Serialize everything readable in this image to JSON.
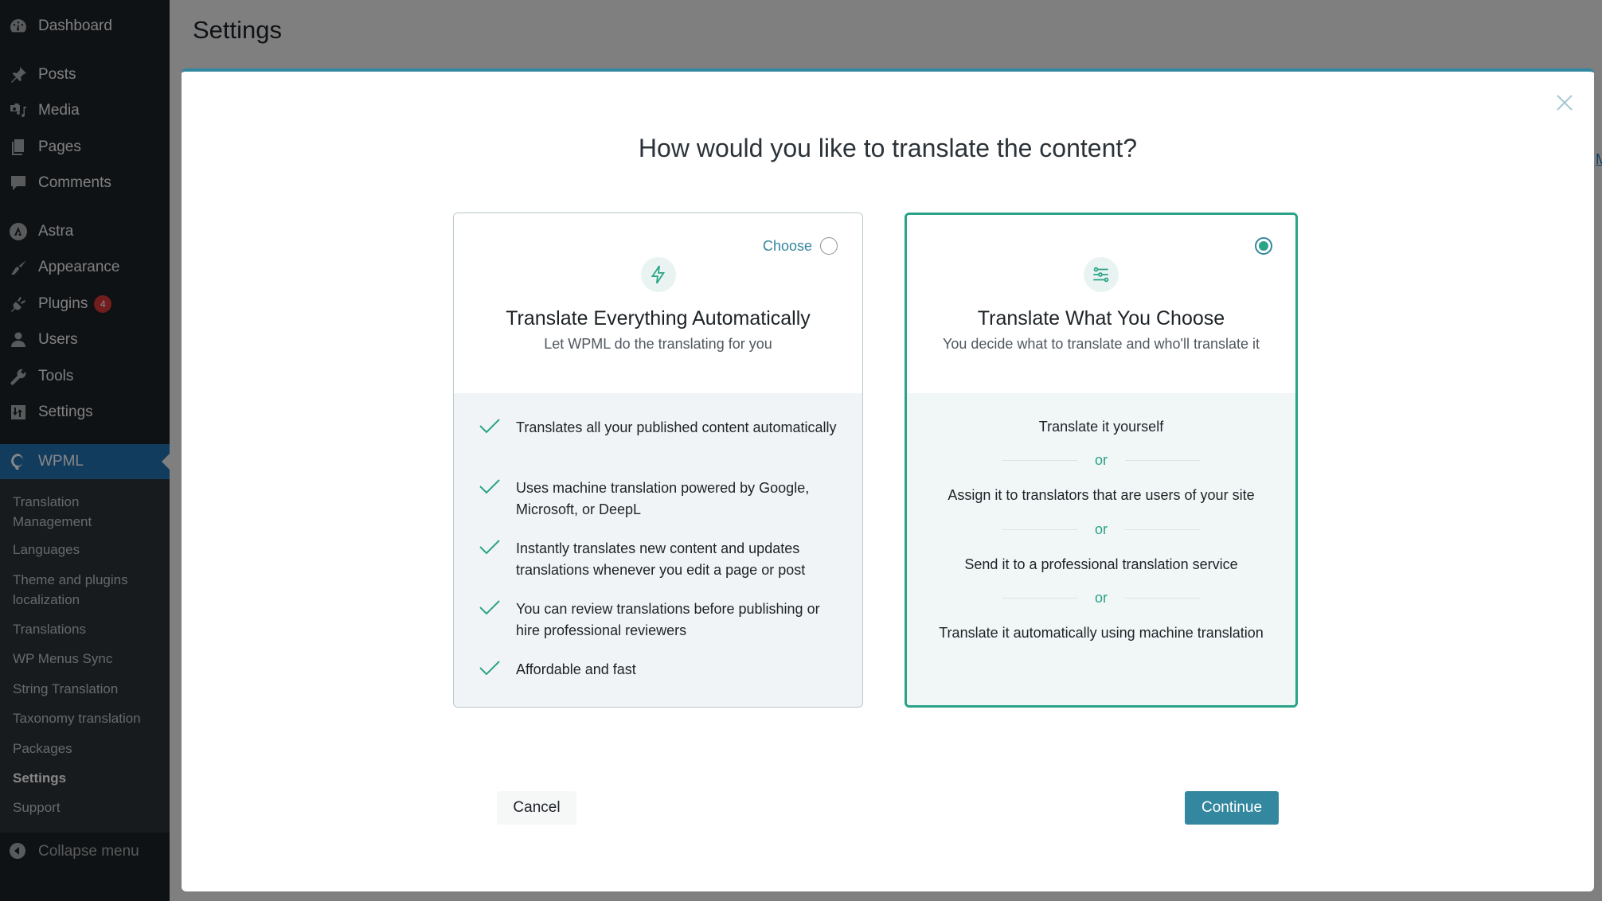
{
  "sidebar": {
    "items": [
      {
        "label": "Dashboard",
        "icon": "dashboard-icon"
      },
      {
        "label": "Posts",
        "icon": "pin-icon"
      },
      {
        "label": "Media",
        "icon": "media-icon"
      },
      {
        "label": "Pages",
        "icon": "pages-icon"
      },
      {
        "label": "Comments",
        "icon": "comment-icon"
      },
      {
        "label": "Astra",
        "icon": "astra-icon"
      },
      {
        "label": "Appearance",
        "icon": "brush-icon"
      },
      {
        "label": "Plugins",
        "icon": "plug-icon",
        "badge": "4"
      },
      {
        "label": "Users",
        "icon": "user-icon"
      },
      {
        "label": "Tools",
        "icon": "wrench-icon"
      },
      {
        "label": "Settings",
        "icon": "settings-icon"
      },
      {
        "label": "WPML",
        "icon": "wpml-icon"
      }
    ],
    "submenu": [
      {
        "label": "Translation Management"
      },
      {
        "label": "Languages"
      },
      {
        "label": "Theme and plugins localization"
      },
      {
        "label": "Translations"
      },
      {
        "label": "WP Menus Sync"
      },
      {
        "label": "String Translation"
      },
      {
        "label": "Taxonomy translation"
      },
      {
        "label": "Packages"
      },
      {
        "label": "Settings",
        "current": true
      },
      {
        "label": "Support"
      }
    ],
    "collapse_label": "Collapse menu"
  },
  "page": {
    "title": "Settings",
    "bg_link": "M"
  },
  "modal": {
    "title": "How would you like to translate the content?",
    "cards": [
      {
        "choose_label": "Choose",
        "selected": false,
        "icon": "lightning-icon",
        "title": "Translate Everything Automatically",
        "subtitle": "Let WPML do the translating for you",
        "features": [
          "Translates all your published content automatically",
          "Uses machine translation powered by Google, Microsoft, or DeepL",
          "Instantly translates new content and updates translations whenever you edit a page or post",
          "You can review translations before publishing or hire professional reviewers",
          "Affordable and fast"
        ]
      },
      {
        "selected": true,
        "icon": "sliders-icon",
        "title": "Translate What You Choose",
        "subtitle": "You decide what to translate and who'll translate it",
        "options": [
          "Translate it yourself",
          "Assign it to translators that are users of your site",
          "Send it to a professional translation service",
          "Translate it automatically using machine translation"
        ],
        "separator": "or"
      }
    ],
    "cancel_label": "Cancel",
    "continue_label": "Continue"
  },
  "colors": {
    "accent": "#33879e",
    "green": "#2aa388",
    "sidebar_bg": "#1d2327",
    "wpml_active": "#2271b1",
    "badge": "#d63638"
  }
}
